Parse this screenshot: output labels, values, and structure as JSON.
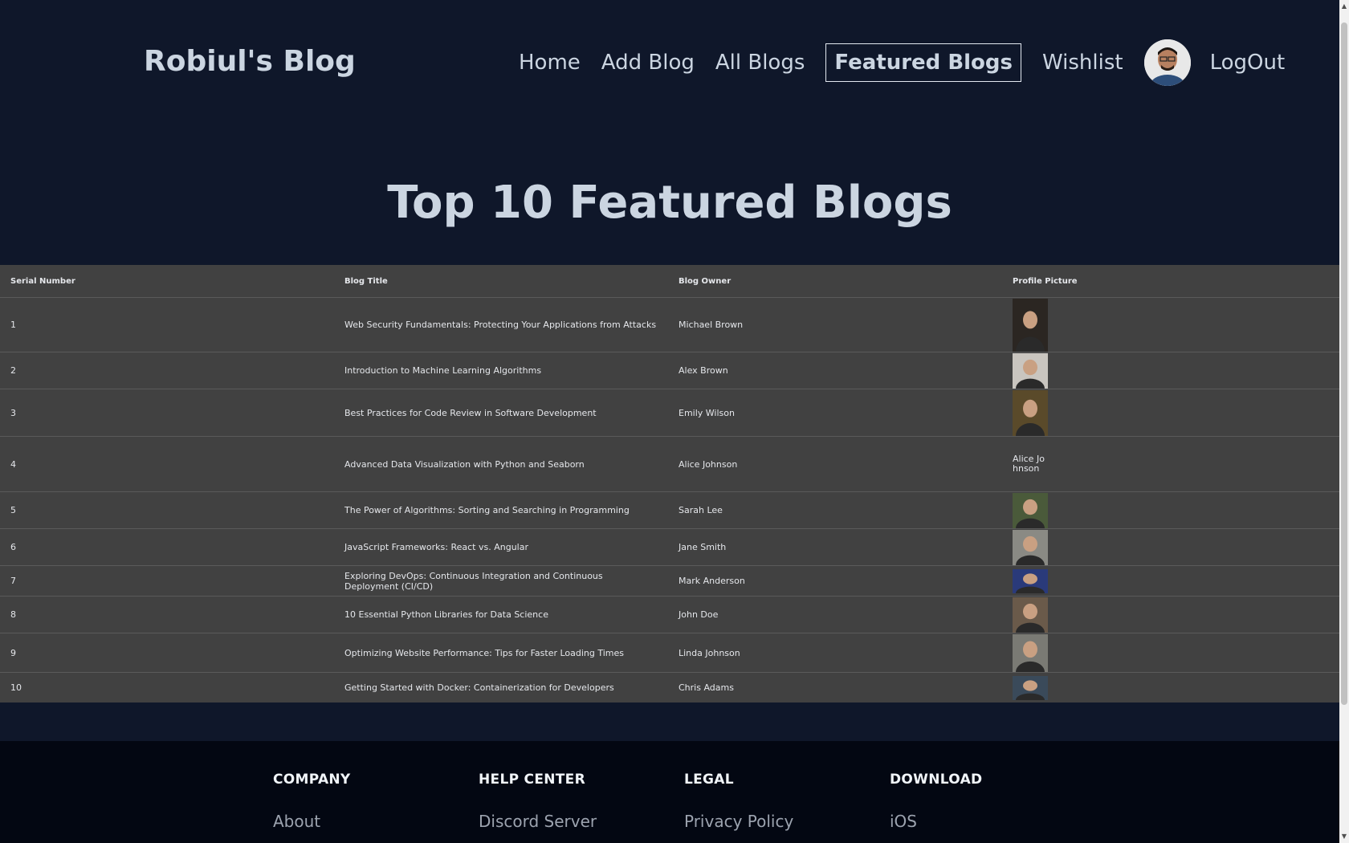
{
  "brand": "Robiul's Blog",
  "nav": {
    "home": "Home",
    "add_blog": "Add Blog",
    "all_blogs": "All Blogs",
    "featured_blogs": "Featured Blogs",
    "wishlist": "Wishlist",
    "logout": "LogOut"
  },
  "page_title": "Top 10 Featured Blogs",
  "table": {
    "headers": [
      "Serial Number",
      "Blog Title",
      "Blog Owner",
      "Profile Picture"
    ],
    "rows": [
      {
        "serial": "1",
        "title": "Web Security Fundamentals: Protecting Your Applications from Attacks",
        "owner": "Michael Brown",
        "pic_alt": "",
        "pic_color": "#2b2622"
      },
      {
        "serial": "2",
        "title": "Introduction to Machine Learning Algorithms",
        "owner": "Alex Brown",
        "pic_alt": "",
        "pic_color": "#c9c5bf"
      },
      {
        "serial": "3",
        "title": "Best Practices for Code Review in Software Development",
        "owner": "Emily Wilson",
        "pic_alt": "",
        "pic_color": "#5a4a2a"
      },
      {
        "serial": "4",
        "title": "Advanced Data Visualization with Python and Seaborn",
        "owner": "Alice Johnson",
        "pic_alt": "Alice Johnson",
        "pic_color": ""
      },
      {
        "serial": "5",
        "title": "The Power of Algorithms: Sorting and Searching in Programming",
        "owner": "Sarah Lee",
        "pic_alt": "",
        "pic_color": "#4a5a3a"
      },
      {
        "serial": "6",
        "title": "JavaScript Frameworks: React vs. Angular",
        "owner": "Jane Smith",
        "pic_alt": "",
        "pic_color": "#8a8a84"
      },
      {
        "serial": "7",
        "title": "Exploring DevOps: Continuous Integration and Continuous Deployment (CI/CD)",
        "owner": "Mark Anderson",
        "pic_alt": "",
        "pic_color": "#2a3a7a"
      },
      {
        "serial": "8",
        "title": "10 Essential Python Libraries for Data Science",
        "owner": "John Doe",
        "pic_alt": "",
        "pic_color": "#6a5a4a"
      },
      {
        "serial": "9",
        "title": "Optimizing Website Performance: Tips for Faster Loading Times",
        "owner": "Linda Johnson",
        "pic_alt": "",
        "pic_color": "#7a7a74"
      },
      {
        "serial": "10",
        "title": "Getting Started with Docker: Containerization for Developers",
        "owner": "Chris Adams",
        "pic_alt": "",
        "pic_color": "#3a4a5a"
      }
    ]
  },
  "footer": {
    "company": {
      "heading": "COMPANY",
      "link": "About"
    },
    "help": {
      "heading": "HELP CENTER",
      "link": "Discord Server"
    },
    "legal": {
      "heading": "LEGAL",
      "link": "Privacy Policy"
    },
    "download": {
      "heading": "DOWNLOAD",
      "link": "iOS"
    }
  }
}
